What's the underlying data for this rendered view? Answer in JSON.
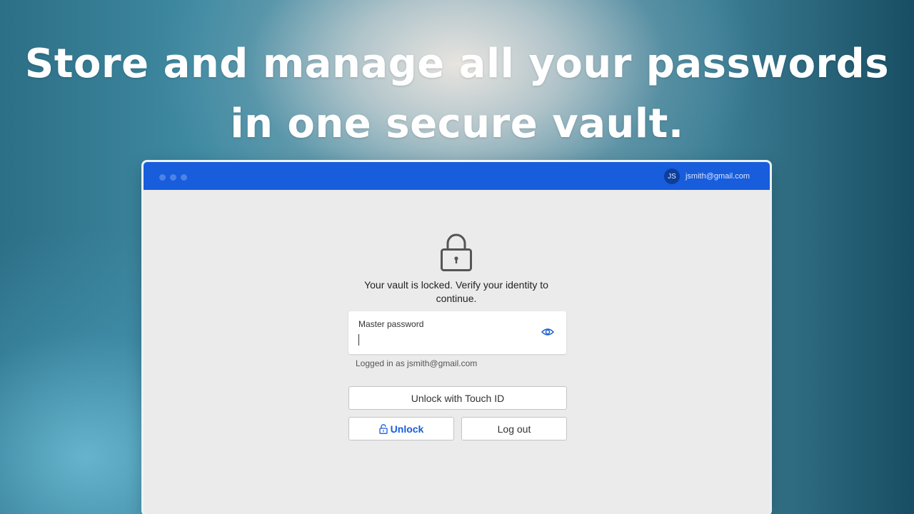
{
  "headline": "Store and manage all your passwords in one secure vault.",
  "window": {
    "account": {
      "initials": "JS",
      "email": "jsmith@gmail.com"
    }
  },
  "lock_screen": {
    "lock_icon": "padlock-icon",
    "message": "Your vault is locked. Verify your identity to continue.",
    "password_field": {
      "label": "Master password",
      "value": "",
      "visibility_icon": "eye-icon"
    },
    "logged_in_text": "Logged in as jsmith@gmail.com",
    "buttons": {
      "touch_id": "Unlock with Touch ID",
      "unlock": "Unlock",
      "unlock_icon": "open-padlock-icon",
      "logout": "Log out"
    }
  },
  "colors": {
    "titlebar": "#175ddc",
    "accent": "#175ddc",
    "window_background": "#ebebeb"
  }
}
